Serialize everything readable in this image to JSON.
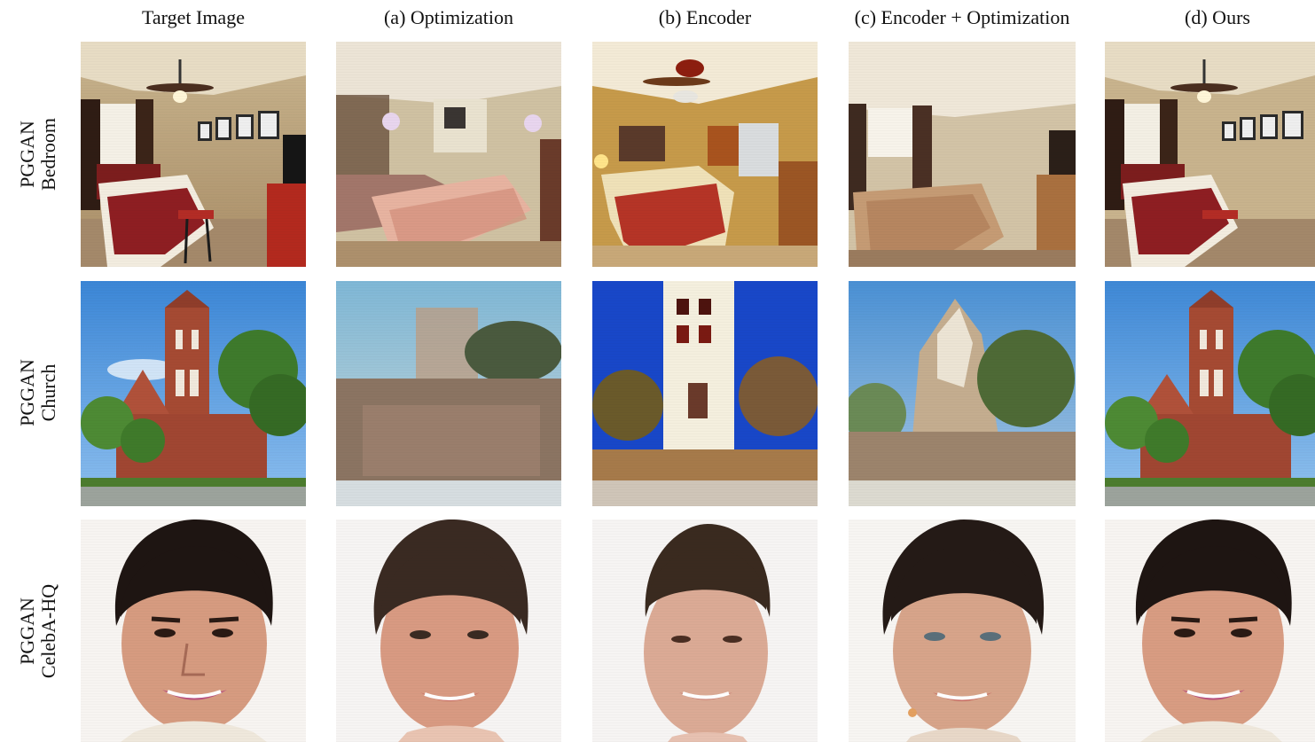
{
  "columns": [
    {
      "label": "Target Image"
    },
    {
      "label": "(a) Optimization"
    },
    {
      "label": "(b) Encoder"
    },
    {
      "label": "(c) Encoder + Optimization"
    },
    {
      "label": "(d) Ours"
    }
  ],
  "rows": [
    {
      "label_line1": "PGGAN",
      "label_line2": "Bedroom"
    },
    {
      "label_line1": "PGGAN",
      "label_line2": "Church"
    },
    {
      "label_line1": "PGGAN",
      "label_line2": "CelebA-HQ"
    }
  ]
}
